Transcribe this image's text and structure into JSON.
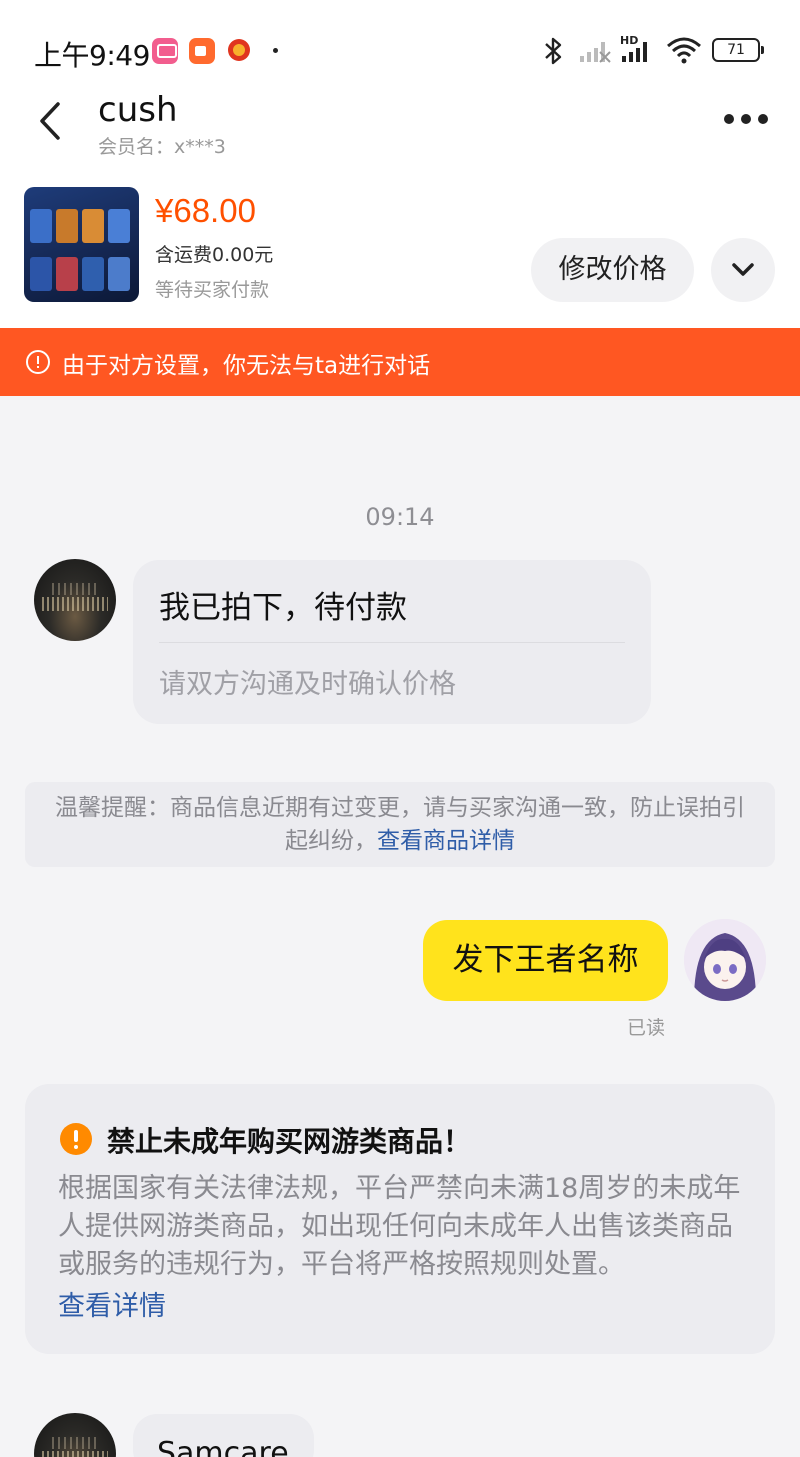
{
  "status_bar": {
    "time": "上午9:49",
    "battery": "71",
    "hd": "HD",
    "icons": [
      "bilibili-app-icon",
      "video-app-icon",
      "red-circle-app-icon",
      "bluetooth-icon",
      "signal-icon",
      "wifi-icon",
      "battery-icon"
    ]
  },
  "header": {
    "title": "cush",
    "subtitle": "会员名：x***3"
  },
  "product": {
    "price": "¥68.00",
    "shipping": "含运费0.00元",
    "status": "等待买家付款",
    "edit_price_label": "修改价格"
  },
  "banner": {
    "text": "由于对方设置，你无法与ta进行对话"
  },
  "chat": {
    "time": "09:14",
    "card_message": {
      "title": "我已拍下，待付款",
      "subtitle": "请双方沟通及时确认价格"
    },
    "notice": {
      "text": "温馨提醒：商品信息近期有过变更，请与买家沟通一致，防止误拍引起纠纷，",
      "link": "查看商品详情"
    },
    "my_message": {
      "text": "发下王者名称",
      "read_status": "已读"
    },
    "warning": {
      "title": "禁止未成年购买网游类商品！",
      "body": "根据国家有关法律法规，平台严禁向未满18周岁的未成年人提供网游类商品，如出现任何向未成年人出售该类商品或服务的违规行为，平台将严格按照规则处置。",
      "link": "查看详情"
    },
    "last_message": {
      "text": "Samcare"
    }
  },
  "colors": {
    "accent": "#ff5000",
    "banner": "#ff5722",
    "my_bubble": "#ffe31c",
    "link": "#2f5da8"
  }
}
